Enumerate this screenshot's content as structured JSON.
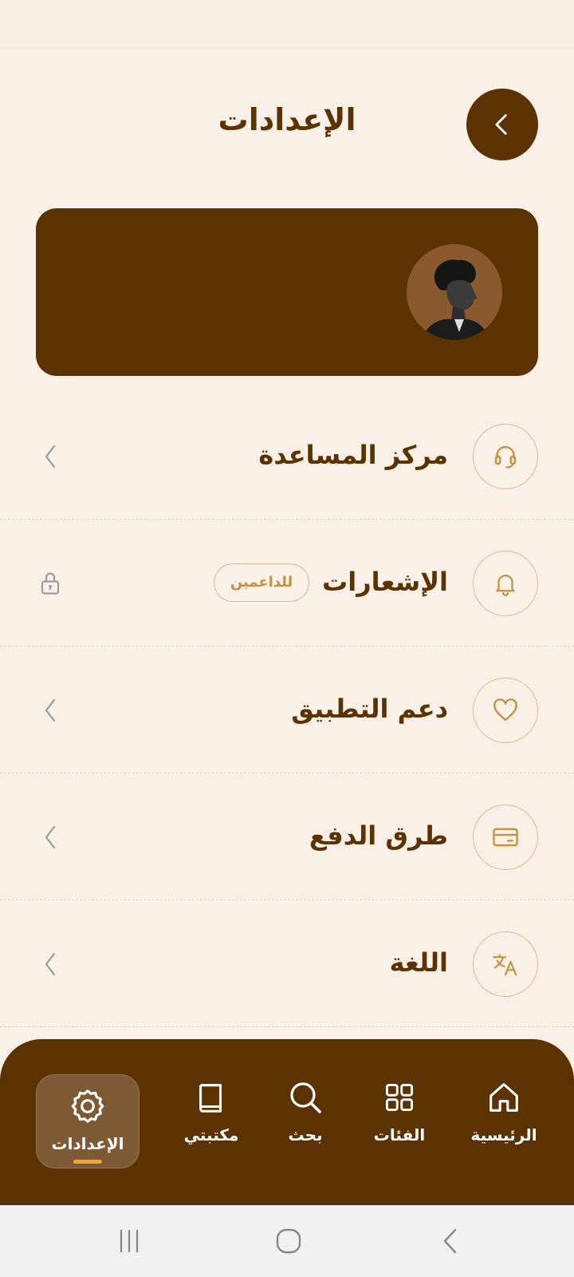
{
  "header": {
    "title": "الإعدادات",
    "back_icon": "chevron-left-icon"
  },
  "menu": [
    {
      "id": "help",
      "label": "مركز المساعدة",
      "icon": "headset-icon",
      "trailing": "chevron"
    },
    {
      "id": "notifications",
      "label": "الإشعارات",
      "icon": "bell-icon",
      "badge": "للداعمين",
      "trailing": "lock"
    },
    {
      "id": "support",
      "label": "دعم التطبيق",
      "icon": "heart-icon",
      "trailing": "chevron"
    },
    {
      "id": "payment",
      "label": "طرق الدفع",
      "icon": "card-icon",
      "trailing": "chevron"
    },
    {
      "id": "language",
      "label": "اللغة",
      "icon": "translate-icon",
      "trailing": "chevron"
    }
  ],
  "bottom_nav": {
    "items": [
      {
        "id": "home",
        "label": "الرئيسية",
        "icon": "home-icon"
      },
      {
        "id": "categories",
        "label": "الفئات",
        "icon": "grid-icon"
      },
      {
        "id": "search",
        "label": "بحث",
        "icon": "search-icon"
      },
      {
        "id": "library",
        "label": "مكتبتي",
        "icon": "book-icon"
      },
      {
        "id": "settings",
        "label": "الإعدادات",
        "icon": "gear-icon",
        "active": true
      }
    ]
  },
  "colors": {
    "primary": "#5b3200",
    "background": "#f9f1e7",
    "accent": "#e0b98a",
    "badge_text": "#c8913f",
    "active_indicator": "#f2a72e"
  }
}
